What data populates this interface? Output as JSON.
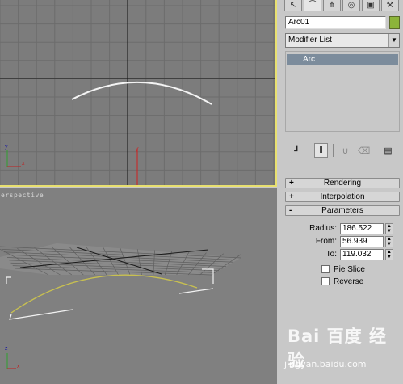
{
  "viewports": {
    "top": {
      "label": ""
    },
    "perspective": {
      "label": "erspective"
    }
  },
  "command_panel": {
    "tabs": [
      {
        "name": "create-tab",
        "icon": "pointer-arrow-icon"
      },
      {
        "name": "modify-tab",
        "icon": "modify-arc-icon"
      },
      {
        "name": "hierarchy-tab",
        "icon": "hierarchy-icon"
      },
      {
        "name": "motion-tab",
        "icon": "motion-icon"
      },
      {
        "name": "display-tab",
        "icon": "display-icon"
      },
      {
        "name": "utilities-tab",
        "icon": "hammer-icon"
      }
    ],
    "object_name": "Arc01",
    "object_color": "#8cb43a",
    "modifier_list": "Modifier List",
    "stack_items": [
      "Arc"
    ],
    "stack_tools": [
      "pin-stack-icon",
      "show-end-result-icon",
      "make-unique-icon",
      "remove-modifier-icon",
      "configure-sets-icon"
    ]
  },
  "rollouts": {
    "rendering": {
      "sign": "+",
      "label": "Rendering"
    },
    "interpolation": {
      "sign": "+",
      "label": "Interpolation"
    },
    "parameters": {
      "sign": "-",
      "label": "Parameters"
    }
  },
  "parameters": {
    "radius_label": "Radius:",
    "radius_value": "186.522",
    "from_label": "From:",
    "from_value": "56.939",
    "to_label": "To:",
    "to_value": "119.032",
    "pie_slice_label": "Pie Slice",
    "pie_slice_checked": false,
    "reverse_label": "Reverse",
    "reverse_checked": false
  },
  "watermark": {
    "logo": "Bai 百度 经验",
    "url": "jingyan.baidu.com"
  }
}
